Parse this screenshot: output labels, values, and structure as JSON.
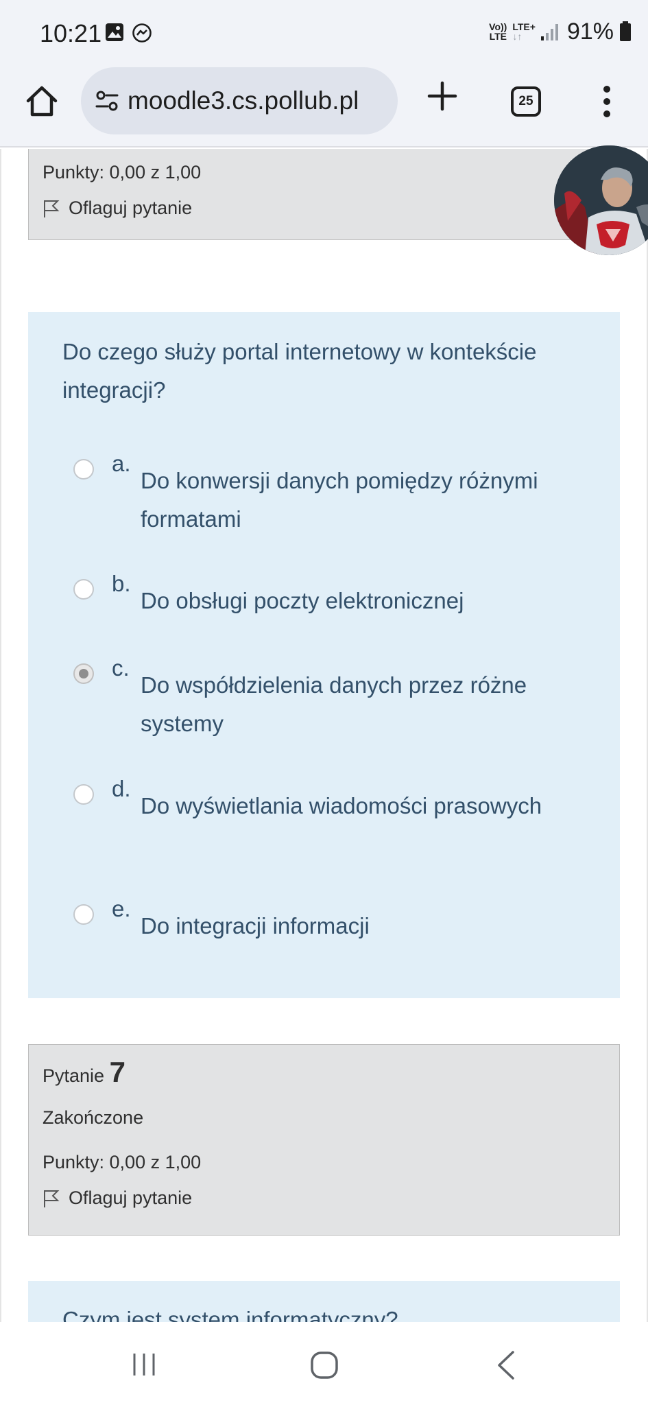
{
  "status_bar": {
    "time": "10:21",
    "network_top": "Vo))",
    "network_bottom": "LTE",
    "lte_plus": "LTE+",
    "lte_arrows": "↓↑",
    "battery": "91%"
  },
  "browser": {
    "url_domain": "moodle3.cs.pollub.pl",
    "tab_count": "25"
  },
  "previous_question_info": {
    "points": "Punkty: 0,00 z 1,00",
    "flag_label": "Oflaguj pytanie"
  },
  "question": {
    "text": "Do czego służy portal internetowy w kontekście integracji?",
    "answers": [
      {
        "letter": "a.",
        "text": "Do konwersji danych pomiędzy różnymi formatami",
        "selected": false
      },
      {
        "letter": "b.",
        "text": "Do obsługi poczty elektronicznej",
        "selected": false
      },
      {
        "letter": "c.",
        "text": "Do współdzielenia danych przez różne systemy",
        "selected": true
      },
      {
        "letter": "d.",
        "text": "Do wyświetlania wiadomości prasowych",
        "selected": false
      },
      {
        "letter": "e.",
        "text": "Do integracji informacji",
        "selected": false
      }
    ]
  },
  "next_question_info": {
    "label": "Pytanie",
    "number": "7",
    "state": "Zakończone",
    "points": "Punkty: 0,00 z 1,00",
    "flag_label": "Oflaguj pytanie"
  },
  "next_question": {
    "text": "Czym jest system informatyczny?"
  },
  "colors": {
    "question_bg": "#e1eff8",
    "info_bg": "#e2e3e4",
    "question_text": "#33506a"
  }
}
